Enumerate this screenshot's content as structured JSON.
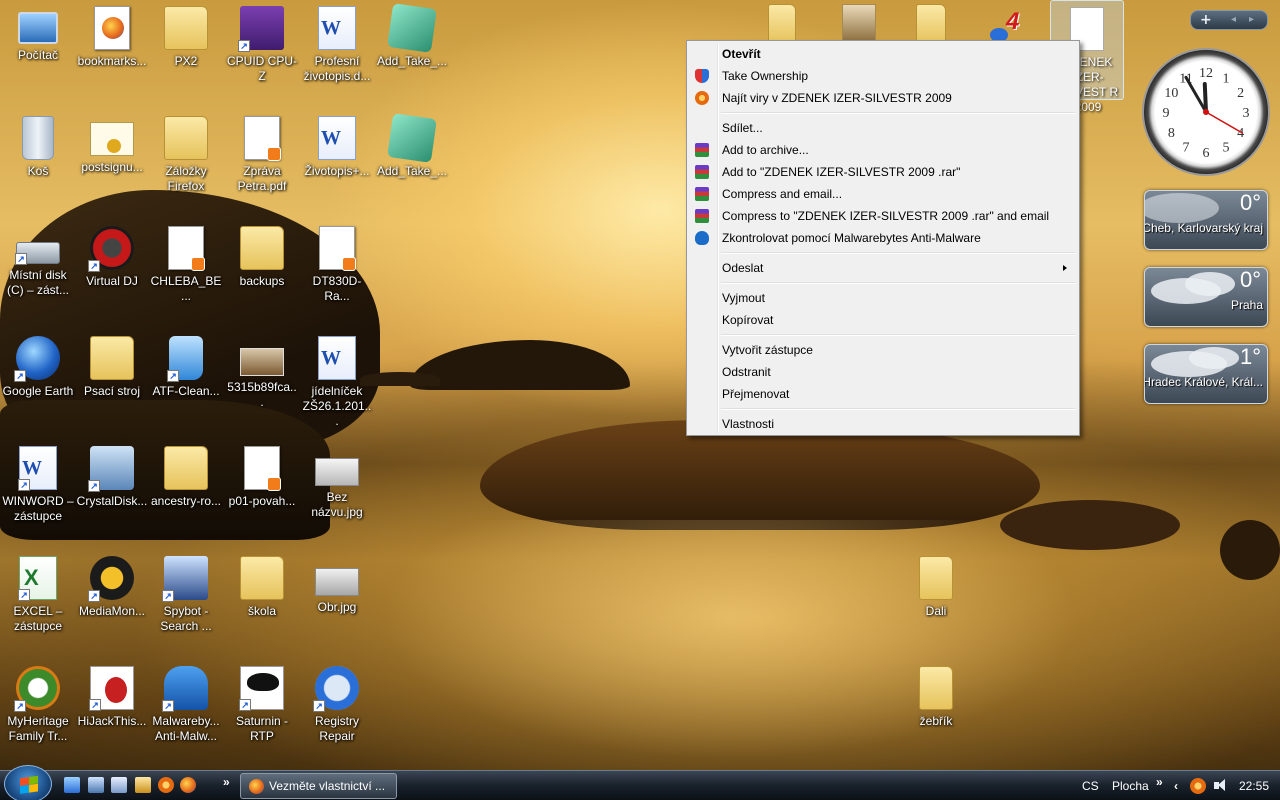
{
  "desktop_icons": [
    {
      "label": "Počítač"
    },
    {
      "label": "bookmarks..."
    },
    {
      "label": "PX2"
    },
    {
      "label": "CPUID CPU-Z"
    },
    {
      "label": "Profesní životopis.d..."
    },
    {
      "label": "Add_Take_..."
    },
    {
      "label": "Koš"
    },
    {
      "label": "postsignu..."
    },
    {
      "label": "Záložky Firefox"
    },
    {
      "label": "Zpráva Petra.pdf"
    },
    {
      "label": "Životopis+..."
    },
    {
      "label": "Add_Take_..."
    },
    {
      "label": "Místní disk (C) – zást..."
    },
    {
      "label": "Virtual DJ"
    },
    {
      "label": "CHLEBA_BE..."
    },
    {
      "label": "backups"
    },
    {
      "label": "DT830D-Ra..."
    },
    {
      "label": "Google Earth"
    },
    {
      "label": "Psací stroj"
    },
    {
      "label": "ATF-Clean..."
    },
    {
      "label": "5315b89fca..."
    },
    {
      "label": "jídelníček ZŠ26.1.201..."
    },
    {
      "label": "WINWORD – zástupce"
    },
    {
      "label": "CrystalDisk..."
    },
    {
      "label": "ancestry-ro..."
    },
    {
      "label": "p01-povah..."
    },
    {
      "label": "Bez názvu.jpg"
    },
    {
      "label": "EXCEL – zástupce"
    },
    {
      "label": "MediaMon..."
    },
    {
      "label": "Spybot - Search ..."
    },
    {
      "label": "škola"
    },
    {
      "label": "Obr.jpg"
    },
    {
      "label": "MyHeritage Family Tr..."
    },
    {
      "label": "HiJackThis..."
    },
    {
      "label": "Malwareby... Anti-Malw..."
    },
    {
      "label": "Saturnin - RTP"
    },
    {
      "label": "Registry Repair"
    },
    {
      "label": "Dali"
    },
    {
      "label": "žebřík"
    }
  ],
  "selected_icon": {
    "label": "ZDENEK IZER-SILVEST R 2009"
  },
  "context_menu": {
    "items": [
      {
        "label": "Otevřít",
        "icon": "none"
      },
      {
        "label": "Take Ownership",
        "icon": "shield-icon"
      },
      {
        "label": "Najít viry v ZDENEK IZER-SILVESTR 2009",
        "icon": "avast-icon"
      },
      {
        "label": "Sdílet..."
      },
      {
        "label": "Add to archive...",
        "icon": "winrar-icon"
      },
      {
        "label": "Add to \"ZDENEK IZER-SILVESTR 2009 .rar\"",
        "icon": "winrar-icon"
      },
      {
        "label": "Compress and email...",
        "icon": "winrar-icon"
      },
      {
        "label": "Compress to \"ZDENEK IZER-SILVESTR 2009 .rar\" and email",
        "icon": "winrar-icon"
      },
      {
        "label": "Zkontrolovat pomocí Malwarebytes Anti-Malware",
        "icon": "malwarebytes-icon"
      },
      {
        "label": "Odeslat",
        "icon": "submenu-arrow"
      },
      {
        "label": "Vyjmout"
      },
      {
        "label": "Kopírovat"
      },
      {
        "label": "Vytvořit zástupce"
      },
      {
        "label": "Odstranit"
      },
      {
        "label": "Přejmenovat"
      },
      {
        "label": "Vlastnosti"
      }
    ]
  },
  "gadgets": {
    "controls": {
      "add": "+",
      "prev": "◂",
      "next": "▸"
    },
    "clock": {
      "hour": 11,
      "minute": 55,
      "second": 20,
      "numerals": [
        "12",
        "1",
        "2",
        "3",
        "4",
        "5",
        "6",
        "7",
        "8",
        "9",
        "10",
        "11"
      ]
    },
    "weather": [
      {
        "temp": "0°",
        "location": "Cheb, Karlovarský kraj"
      },
      {
        "temp": "0°",
        "location": "Praha"
      },
      {
        "temp": "1°",
        "location": "Hradec Králové, Král..."
      }
    ]
  },
  "taskbar": {
    "task_item": "Vezměte vlastnictví ...",
    "quicklaunch_more": "»",
    "language": "CS",
    "toolbar_label": "Plocha",
    "toolbar_more": "»",
    "tray_expand": "‹",
    "time": "22:55"
  },
  "colors": {
    "menu_bg": "#f0f0f0",
    "taskbar": "#19212b",
    "desktop_sky": "#e6bd63"
  }
}
